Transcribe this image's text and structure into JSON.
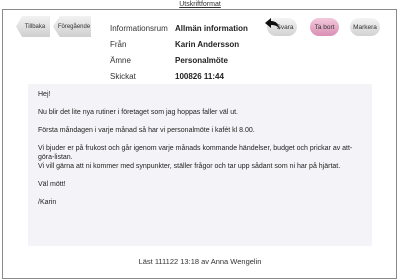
{
  "print_link": "Utskriftformat",
  "nav": {
    "back_label": "Tillbaka",
    "prev_label": "Föregående"
  },
  "meta": {
    "rows": [
      {
        "label": "Informationsrum",
        "value": "Allmän information"
      },
      {
        "label": "Från",
        "value": "Karin Andersson"
      },
      {
        "label": "Ämne",
        "value": "Personalmöte"
      },
      {
        "label": "Skickat",
        "value": "100826 11:44"
      }
    ]
  },
  "actions": {
    "reply_label": "Svara",
    "delete_label": "Ta bort",
    "mark_label": "Markera"
  },
  "message": {
    "paragraphs": [
      "Hej!",
      "Nu blir det lite nya rutiner i företaget som jag hoppas faller väl ut.",
      "Första måndagen i varje månad så har vi personalmöte i kafét kl 8.00.",
      "Vi bjuder er på frukost och går igenom varje månads kommande händelser, budget och prickar av att-göra-listan.\nVi vill gärna att ni kommer med synpunkter, ställer frågor och tar upp sådant som ni har på hjärtat.",
      "Väl mött!",
      "/Karin"
    ]
  },
  "footer": "Läst 111122 13:18 av Anna Wengelin",
  "colors": {
    "delete_accent": "#d98fb4",
    "body_bg": "#f4f4f8"
  }
}
